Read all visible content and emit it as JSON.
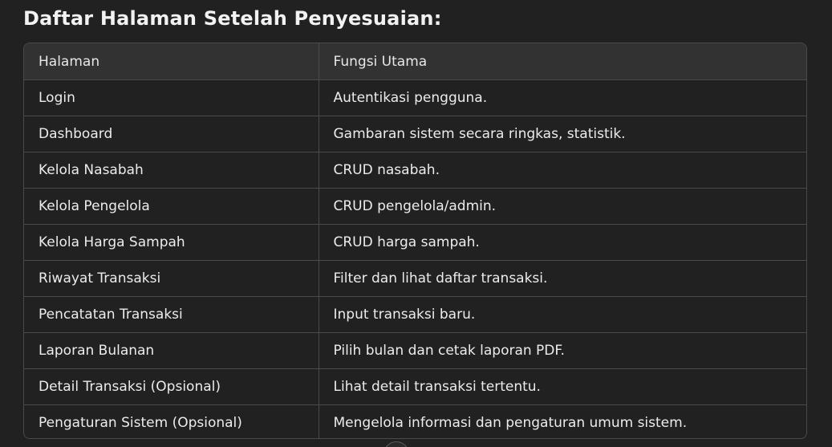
{
  "heading": "Daftar Halaman Setelah Penyesuaian:",
  "table": {
    "headers": [
      "Halaman",
      "Fungsi Utama"
    ],
    "rows": [
      [
        "Login",
        "Autentikasi pengguna."
      ],
      [
        "Dashboard",
        "Gambaran sistem secara ringkas, statistik."
      ],
      [
        "Kelola Nasabah",
        "CRUD nasabah."
      ],
      [
        "Kelola Pengelola",
        "CRUD pengelola/admin."
      ],
      [
        "Kelola Harga Sampah",
        "CRUD harga sampah."
      ],
      [
        "Riwayat Transaksi",
        "Filter dan lihat daftar transaksi."
      ],
      [
        "Pencatatan Transaksi",
        "Input transaksi baru."
      ],
      [
        "Laporan Bulanan",
        "Pilih bulan dan cetak laporan PDF."
      ],
      [
        "Detail Transaksi (Opsional)",
        "Lihat detail transaksi tertentu."
      ],
      [
        "Pengaturan Sistem (Opsional)",
        "Mengelola informasi dan pengaturan umum sistem."
      ]
    ]
  },
  "colors": {
    "background": "#212121",
    "header_row": "#323232",
    "border": "#4a4a4a",
    "text": "#ececec"
  }
}
